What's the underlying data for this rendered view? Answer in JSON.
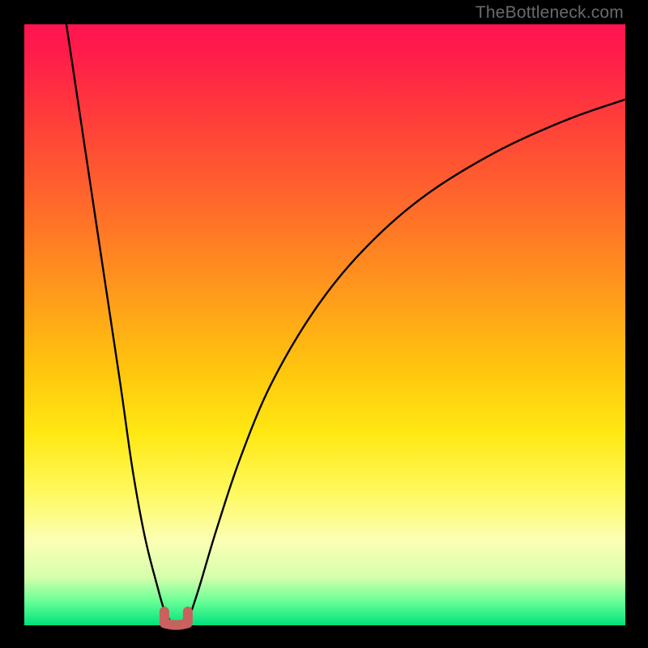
{
  "watermark": {
    "text": "TheBottleneck.com"
  },
  "layout": {
    "canvas_size": 800,
    "margin_left": 30,
    "margin_right": 28,
    "margin_top": 30,
    "margin_bottom": 28
  },
  "colors": {
    "frame": "#000000",
    "curve": "#000000",
    "marker": "#c9615e",
    "watermark": "#6a6a6a"
  },
  "chart_data": {
    "type": "line",
    "title": "",
    "xlabel": "",
    "ylabel": "",
    "xlim": [
      0,
      100
    ],
    "ylim": [
      0,
      100
    ],
    "left_curve": {
      "x": [
        7,
        10,
        13,
        16,
        18,
        20,
        22,
        23.5,
        25
      ],
      "y": [
        100,
        80,
        60,
        40,
        26,
        15,
        7,
        2,
        0
      ]
    },
    "right_curve": {
      "x": [
        27,
        29,
        32,
        36,
        41,
        48,
        56,
        66,
        78,
        90,
        100
      ],
      "y": [
        0,
        6,
        16,
        28,
        40,
        52,
        62,
        71,
        78.5,
        84,
        87.5
      ]
    },
    "marker": {
      "shape": "u",
      "x_range": [
        23.3,
        27.2
      ],
      "y_range": [
        0,
        2.3
      ]
    },
    "grid": false,
    "legend": false
  }
}
